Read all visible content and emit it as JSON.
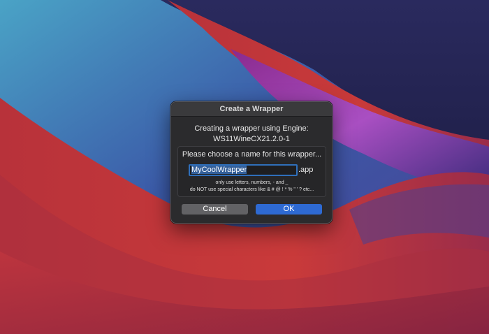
{
  "dialog": {
    "title": "Create a Wrapper",
    "subtitle_line1": "Creating a wrapper using Engine:",
    "subtitle_line2": "WS11WineCX21.2.0-1",
    "prompt": "Please choose a name for this wrapper...",
    "name_value": "MyCoolWrapper",
    "name_suffix": ".app",
    "hint_line1": "only use letters, numbers, - and _",
    "hint_line2": "do NOT use special characters like & # @ ! * % \" ' ? etc...",
    "cancel_label": "Cancel",
    "ok_label": "OK"
  },
  "colors": {
    "accent": "#2e6ad3",
    "dialog_bg": "#2b2b2d",
    "cancel_bg": "#626265"
  }
}
